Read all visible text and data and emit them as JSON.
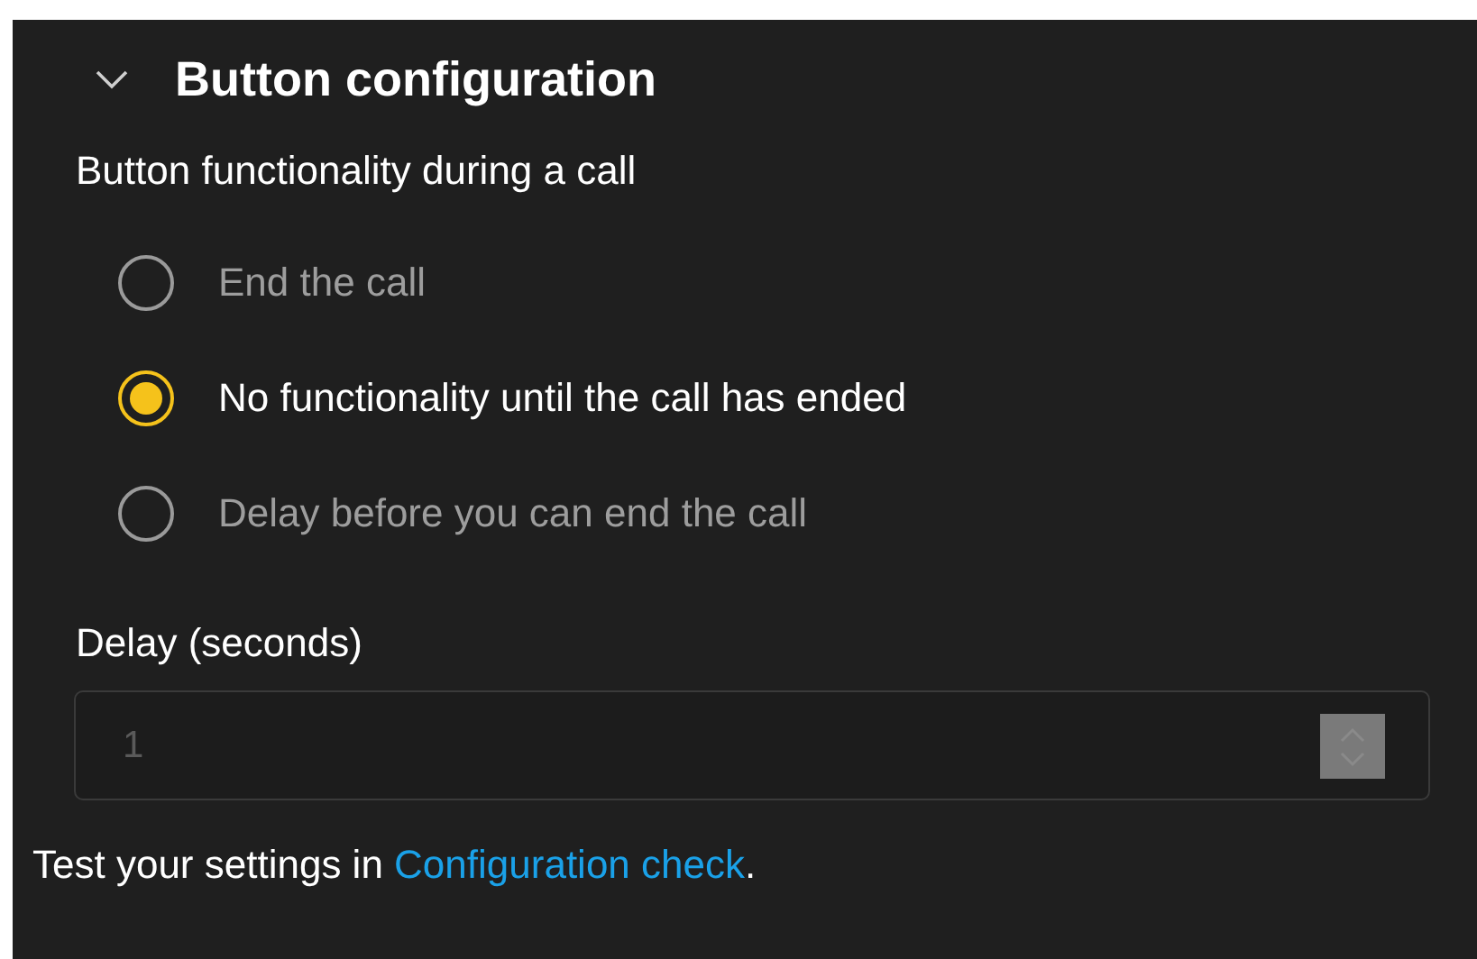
{
  "section": {
    "title": "Button configuration",
    "expanded": true
  },
  "group_label": "Button functionality during a call",
  "options": [
    {
      "label": "End the call",
      "selected": false
    },
    {
      "label": "No functionality until the call has ended",
      "selected": true
    },
    {
      "label": "Delay before you can end the call",
      "selected": false
    }
  ],
  "delay_field": {
    "label": "Delay (seconds)",
    "value": "1",
    "disabled": true
  },
  "footer": {
    "text": "Test your settings in ",
    "link": "Configuration check",
    "after": "."
  }
}
